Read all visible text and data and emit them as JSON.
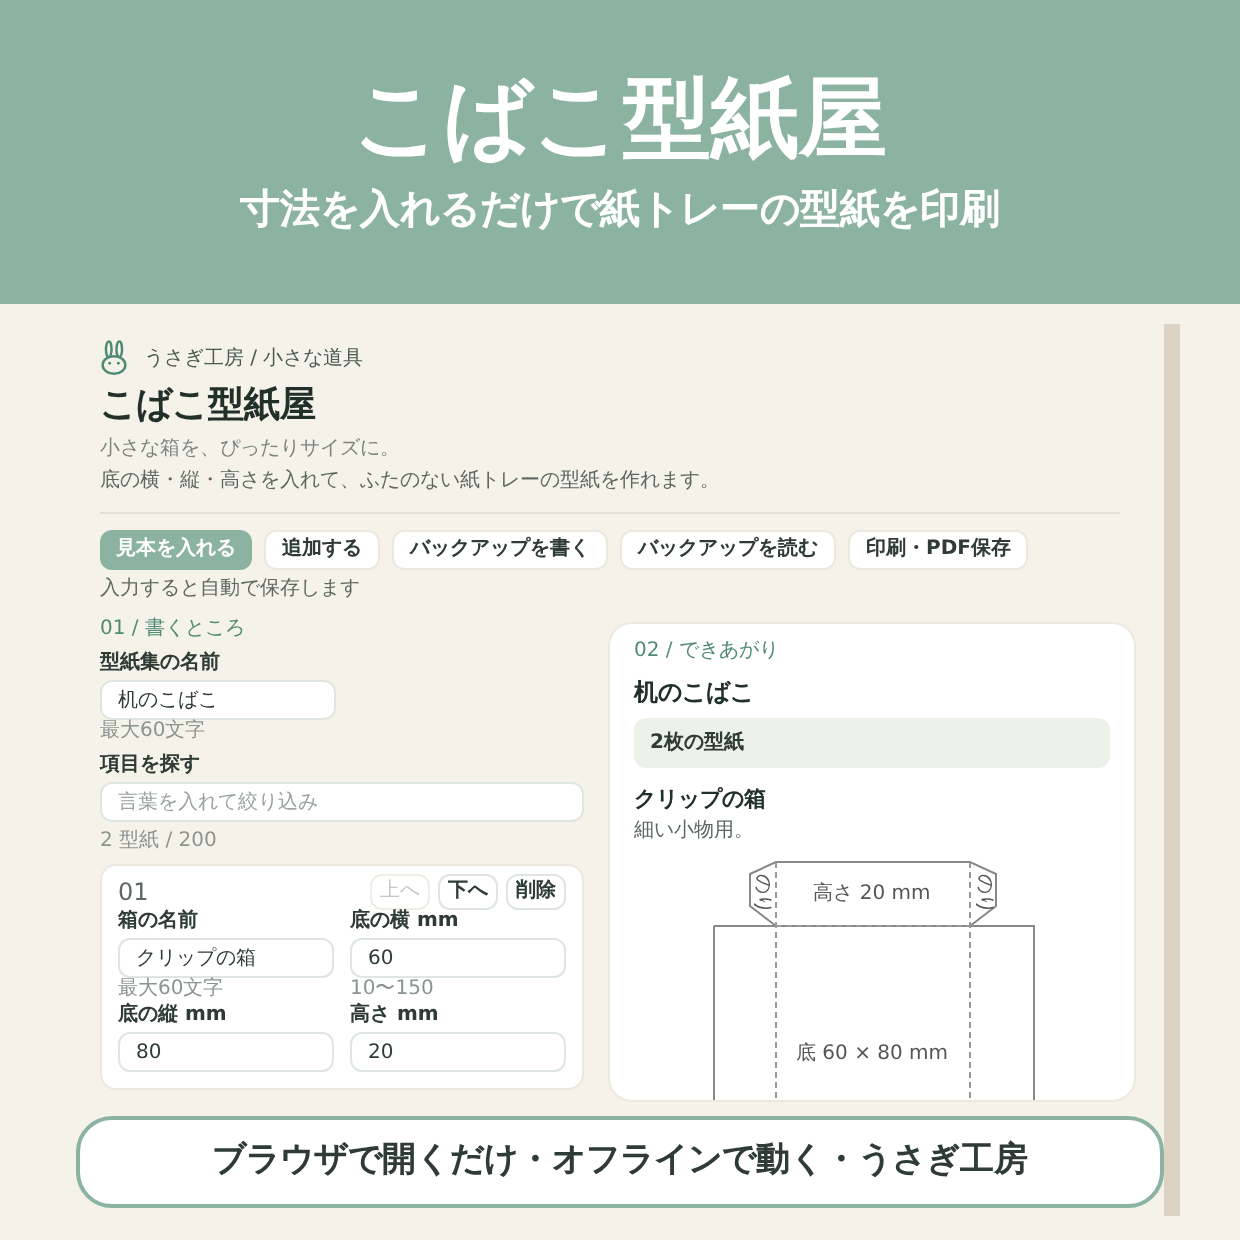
{
  "promo": {
    "title": "こばこ型紙屋",
    "subtitle": "寸法を入れるだけで紙トレーの型紙を印刷",
    "banner": "ブラウザで開くだけ・オフラインで動く・うさぎ工房"
  },
  "app": {
    "breadcrumb": "うさぎ工房 / 小さな道具",
    "title": "こばこ型紙屋",
    "tagline": "小さな箱を、ぴったりサイズに。",
    "description": "底の横・縦・高さを入れて、ふたのない紙トレーの型紙を作れます。",
    "actions": [
      {
        "label": "見本を入れる",
        "primary": true
      },
      {
        "label": "追加する",
        "primary": false
      },
      {
        "label": "バックアップを書く",
        "primary": false
      },
      {
        "label": "バックアップを読む",
        "primary": false
      },
      {
        "label": "印刷・PDF保存",
        "primary": false
      }
    ],
    "autosave_note": "入力すると自動で保存します",
    "editor": {
      "section": "01 / 書くところ",
      "set_name": {
        "label": "型紙集の名前",
        "value": "机のこばこ",
        "hint": "最大60文字"
      },
      "search": {
        "label": "項目を探す",
        "placeholder": "言葉を入れて絞り込み"
      },
      "count": "2 型紙 / 200",
      "items": [
        {
          "number": "01",
          "controls": [
            {
              "label": "上へ",
              "disabled": true
            },
            {
              "label": "下へ",
              "disabled": false
            },
            {
              "label": "削除",
              "disabled": false
            }
          ],
          "fields": [
            {
              "label": "箱の名前",
              "value": "クリップの箱",
              "hint": "最大60文字"
            },
            {
              "label": "底の横 mm",
              "value": "60",
              "hint": "10〜150"
            },
            {
              "label": "底の縦 mm",
              "value": "80"
            },
            {
              "label": "高さ mm",
              "value": "20"
            }
          ]
        }
      ]
    },
    "preview": {
      "section": "02 / できあがり",
      "title": "机のこばこ",
      "summary": "2枚の型紙",
      "box_name": "クリップの箱",
      "box_note": "細い小物用。",
      "diagram": {
        "height_label": "高さ 20 mm",
        "flap_labels": [
          "のり",
          "のり"
        ],
        "bottom_label": "底 60 × 80 mm"
      }
    }
  }
}
